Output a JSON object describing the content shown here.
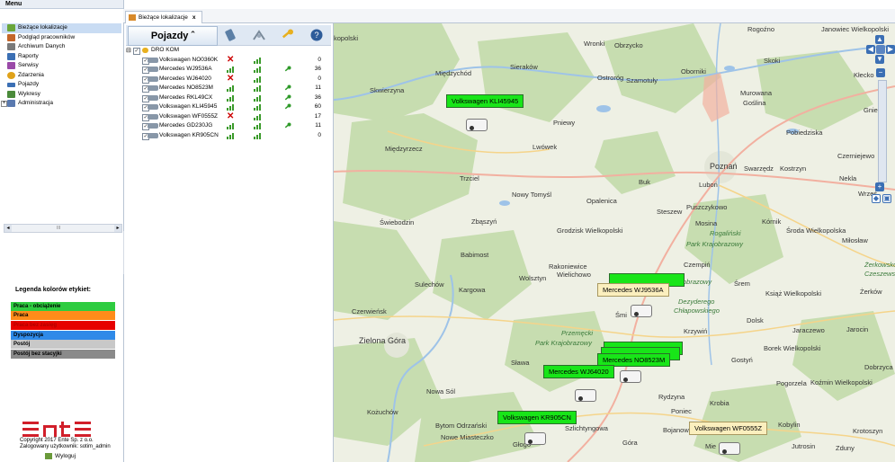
{
  "menu": {
    "title": "Menu",
    "items": [
      {
        "label": "Bieżące lokalizacje",
        "icon": "location-map-icon",
        "color": "#6aa63a",
        "selected": true
      },
      {
        "label": "Podgląd pracowników",
        "icon": "workers-icon",
        "color": "#c4662a"
      },
      {
        "label": "Archiwum Danych",
        "icon": "archive-icon",
        "color": "#7a7a7a"
      },
      {
        "label": "Raporty",
        "icon": "report-icon",
        "color": "#3b6fb4"
      },
      {
        "label": "Serwisy",
        "icon": "service-tools-icon",
        "color": "#9a4aa8"
      },
      {
        "label": "Zdarzenia",
        "icon": "warning-icon",
        "color": "#e0a21a"
      },
      {
        "label": "Pojazdy",
        "icon": "vehicle-icon",
        "color": "#3b6fb4"
      },
      {
        "label": "Wykresy",
        "icon": "chart-icon",
        "color": "#4a8a3a"
      },
      {
        "label": "Administracja",
        "icon": "admin-icon",
        "color": "#5a7ab0",
        "expandable": true
      }
    ],
    "scroll_label": "III"
  },
  "legend": {
    "title": "Legenda kolorów etykiet:",
    "items": [
      {
        "label": "Praca - obciążenie",
        "color": "#2ecc40",
        "text_color": "#000"
      },
      {
        "label": "Praca",
        "color": "#ff8c1a",
        "text_color": "#000"
      },
      {
        "label": "Praca bez zasięg",
        "color": "#e60000",
        "text_color": "#b00000"
      },
      {
        "label": "Dyspozycja",
        "color": "#2f8ae8",
        "text_color": "#000"
      },
      {
        "label": "Postój",
        "color": "#c8c8c8",
        "text_color": "#000"
      },
      {
        "label": "Postój bez stacyjki",
        "color": "#8a8a8a",
        "text_color": "#000"
      }
    ]
  },
  "footer": {
    "copyright": "Copyright 2017 Ente Sp. z o.o.",
    "user": "Zalogowany użytkownik: sotim_admin",
    "logout": "Wyloguj",
    "logo": "ente"
  },
  "tab": {
    "label": "Bieżące lokalizacje",
    "close": "x"
  },
  "vehicles_panel": {
    "header": "Pojazdy ˆ",
    "header_icons": [
      "phone-icon",
      "satellite-signal-icon",
      "key-icon",
      "help-icon"
    ],
    "group": "DRO KOM",
    "rows": [
      {
        "name": "Volkswagen NO0360K",
        "status": "x",
        "signal2": true,
        "key": false,
        "value": "0"
      },
      {
        "name": "Mercedes WJ9536A",
        "status": "signal",
        "signal2": true,
        "key": true,
        "value": "36"
      },
      {
        "name": "Mercedes WJ64020",
        "status": "x",
        "signal2": true,
        "key": false,
        "value": "0"
      },
      {
        "name": "Mercedes NO8523M",
        "status": "signal",
        "signal2": true,
        "key": true,
        "value": "11"
      },
      {
        "name": "Mercedes RKL49CX",
        "status": "signal",
        "signal2": true,
        "key": true,
        "value": "36"
      },
      {
        "name": "Volkswagen KLI45945",
        "status": "signal",
        "signal2": true,
        "key": true,
        "value": "60"
      },
      {
        "name": "Volkswagen WF0555Z",
        "status": "x",
        "signal2": true,
        "key": false,
        "value": "17"
      },
      {
        "name": "Mercedes GD230JG",
        "status": "signal",
        "signal2": true,
        "key": true,
        "value": "11"
      },
      {
        "name": "Volkswagen KR905CN",
        "status": "signal",
        "signal2": true,
        "key": false,
        "value": "0"
      }
    ]
  },
  "map": {
    "places": [
      {
        "n": "kopolski"
      },
      {
        "n": "Wronki"
      },
      {
        "n": "Obrzycko"
      },
      {
        "n": "Rogoźno"
      },
      {
        "n": "Janowiec Wielkopolski"
      },
      {
        "n": "Sieraków"
      },
      {
        "n": "Międzychód"
      },
      {
        "n": "Ostroróg"
      },
      {
        "n": "Szamotuły"
      },
      {
        "n": "Oborniki"
      },
      {
        "n": "Skoki"
      },
      {
        "n": "Kłecko"
      },
      {
        "n": "Skwierzyna"
      },
      {
        "n": "Murowana Goślina"
      },
      {
        "n": "Pniewy"
      },
      {
        "n": "Pobiedziska"
      },
      {
        "n": "Gniezno"
      },
      {
        "n": "Międzyrzecz"
      },
      {
        "n": "Lwówek"
      },
      {
        "n": "Czerniejewo"
      },
      {
        "n": "Poznań"
      },
      {
        "n": "Swarzędz"
      },
      {
        "n": "Kostrzyn"
      },
      {
        "n": "Trzciel"
      },
      {
        "n": "Buk"
      },
      {
        "n": "Luboń"
      },
      {
        "n": "Nekla"
      },
      {
        "n": "Nowy Tomyśl"
      },
      {
        "n": "Opalenica"
      },
      {
        "n": "Steszew"
      },
      {
        "n": "Puszczykowo"
      },
      {
        "n": "Września"
      },
      {
        "n": "Świebodzin"
      },
      {
        "n": "Zbąszyń"
      },
      {
        "n": "Mosina"
      },
      {
        "n": "Kórnik"
      },
      {
        "n": "Grodzisk Wielkopolski"
      },
      {
        "n": "Środa Wielkopolska"
      },
      {
        "n": "Miłosław"
      },
      {
        "n": "Babimost"
      },
      {
        "n": "Rakoniewice"
      },
      {
        "n": "Czempiń"
      },
      {
        "n": "Sulechów"
      },
      {
        "n": "Wielichowo"
      },
      {
        "n": "Wolsztyn"
      },
      {
        "n": "Śrem"
      },
      {
        "n": "Kargowa"
      },
      {
        "n": "Książ Wielkopolski"
      },
      {
        "n": "Żerków"
      },
      {
        "n": "Czerwieńsk"
      },
      {
        "n": "Śmigiel"
      },
      {
        "n": "Dolsk"
      },
      {
        "n": "Jaraczewo"
      },
      {
        "n": "Jarocin"
      },
      {
        "n": "Zielona Góra"
      },
      {
        "n": "Krzywiń"
      },
      {
        "n": "Borek Wielkopolski"
      },
      {
        "n": "Sława"
      },
      {
        "n": "Gostyń"
      },
      {
        "n": "Dobrzyca"
      },
      {
        "n": "Pogorzela"
      },
      {
        "n": "Koźmin Wielkopolski"
      },
      {
        "n": "Nowa Sól"
      },
      {
        "n": "Rydzyna"
      },
      {
        "n": "Poniec"
      },
      {
        "n": "Krobia"
      },
      {
        "n": "Kożuchów"
      },
      {
        "n": "Bytom Odrzański"
      },
      {
        "n": "Szlichtyngowa"
      },
      {
        "n": "Bojanowo"
      },
      {
        "n": "Kobylin"
      },
      {
        "n": "Krotoszyn"
      },
      {
        "n": "Nowe Miasteczko"
      },
      {
        "n": "Głogów"
      },
      {
        "n": "Góra"
      },
      {
        "n": "Jutrosin"
      },
      {
        "n": "Zduny"
      },
      {
        "n": "Miejska Górka"
      }
    ],
    "parks": [
      "Rogaliński Park Krajobrazowy",
      "Dezyderego Chłapowskiego",
      "Przemęcki Park Krajobrazowy",
      "Żerkowsko-Czeszewski Park"
    ],
    "vehicle_labels": [
      {
        "label": "Volkswagen KLI45945",
        "style": "green"
      },
      {
        "label": "Mercedes WJ9536A",
        "style": "beige"
      },
      {
        "label": "Mercedes NO8523M",
        "style": "green"
      },
      {
        "label": "Mercedes WJ64020",
        "style": "green"
      },
      {
        "label": "Volkswagen KR905CN",
        "style": "green"
      },
      {
        "label": "Volkswagen WF0555Z",
        "style": "beige"
      }
    ],
    "controls": {
      "zoom_in": "+",
      "zoom_out": "−",
      "pan_up": "▲",
      "pan_down": "▼",
      "pan_left": "◀",
      "pan_right": "▶"
    }
  }
}
